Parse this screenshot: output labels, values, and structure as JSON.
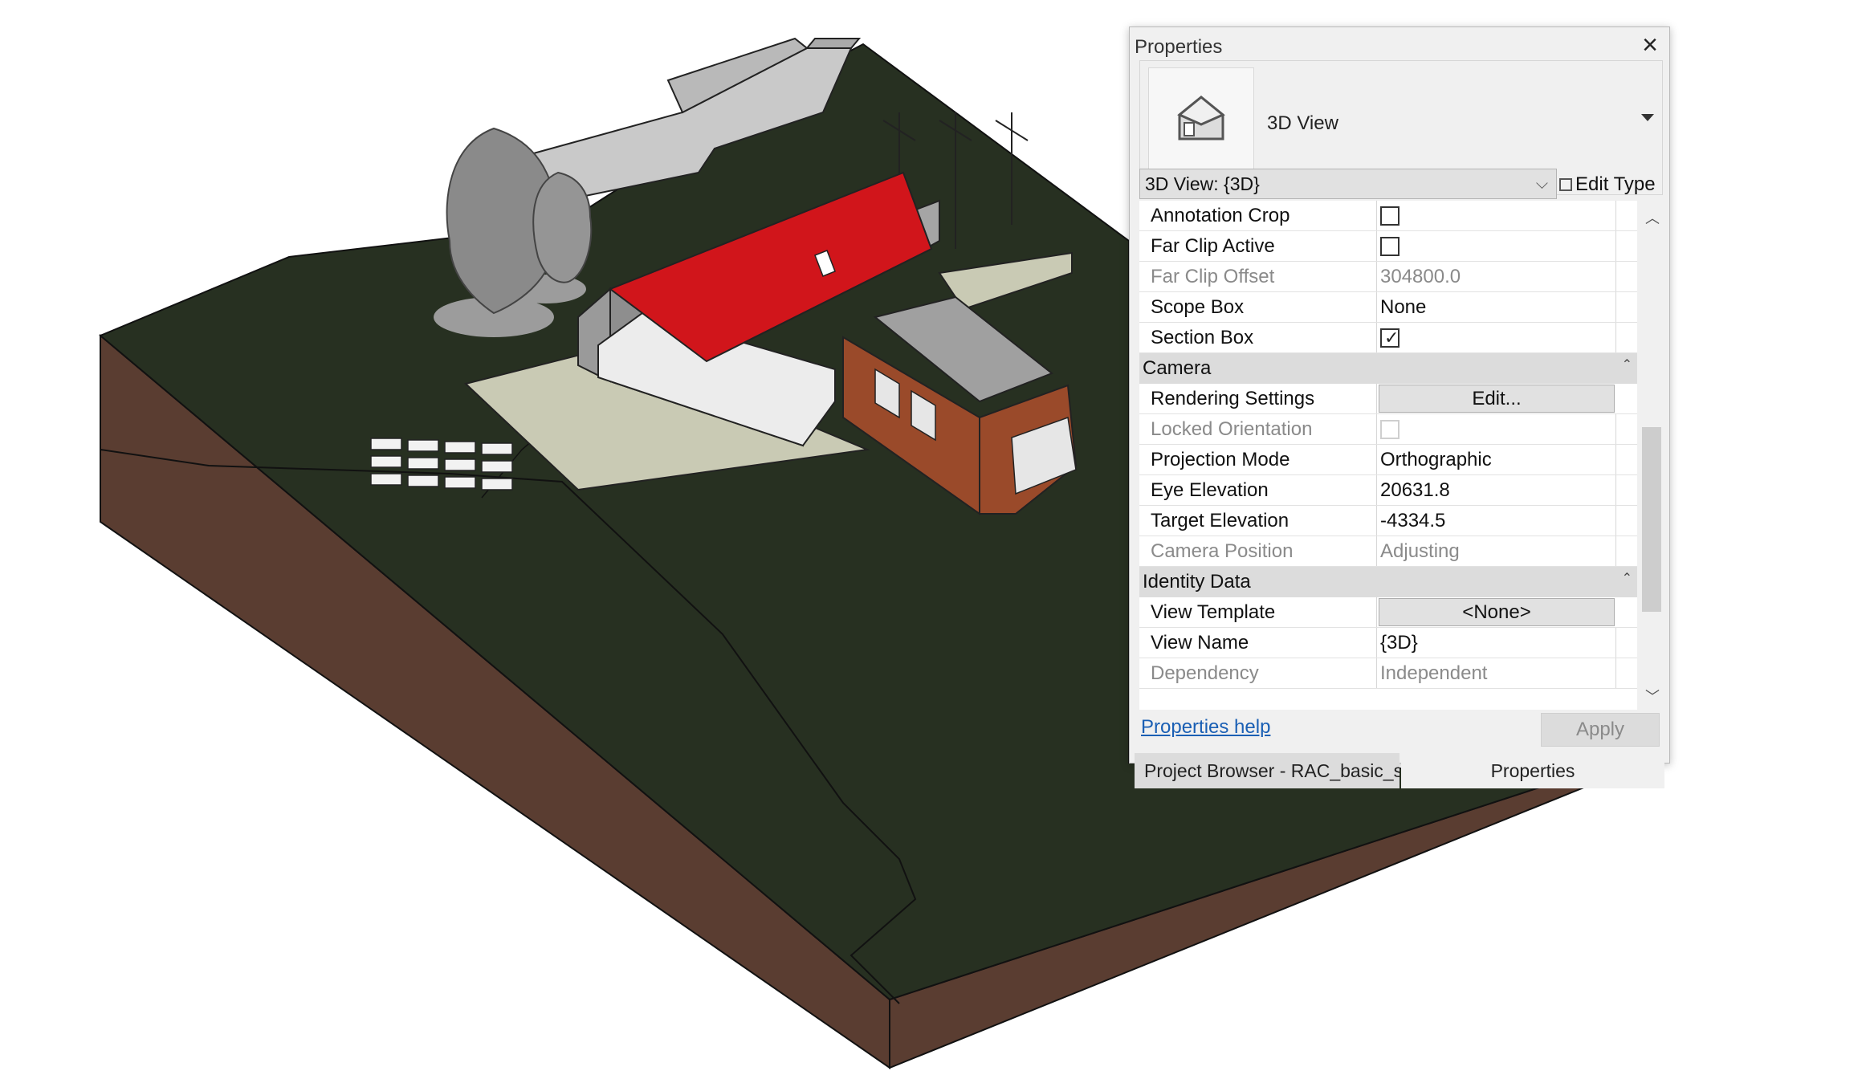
{
  "palette": {
    "title": "Properties",
    "type_name": "3D View",
    "instance": "3D View: {3D}",
    "edit_type": "Edit Type",
    "help_link": "Properties help",
    "apply": "Apply"
  },
  "rows": {
    "annotation_crop": {
      "name": "Annotation Crop",
      "checked": false
    },
    "far_clip_active": {
      "name": "Far Clip Active",
      "checked": false
    },
    "far_clip_offset": {
      "name": "Far Clip Offset",
      "value": "304800.0"
    },
    "scope_box": {
      "name": "Scope Box",
      "value": "None"
    },
    "section_box": {
      "name": "Section Box",
      "checked": true
    },
    "camera_group": "Camera",
    "rendering_settings": {
      "name": "Rendering Settings",
      "value": "Edit..."
    },
    "locked_orientation": {
      "name": "Locked Orientation",
      "checked": false
    },
    "projection_mode": {
      "name": "Projection Mode",
      "value": "Orthographic"
    },
    "eye_elevation": {
      "name": "Eye Elevation",
      "value": "20631.8"
    },
    "target_elevation": {
      "name": "Target Elevation",
      "value": "-4334.5"
    },
    "camera_position": {
      "name": "Camera Position",
      "value": "Adjusting"
    },
    "identity_group": "Identity Data",
    "view_template": {
      "name": "View Template",
      "value": "<None>"
    },
    "view_name": {
      "name": "View Name",
      "value": "{3D}"
    },
    "dependency": {
      "name": "Dependency",
      "value": "Independent"
    }
  },
  "tabs": {
    "project_browser": "Project Browser - RAC_basic_s",
    "properties": "Properties"
  },
  "colors": {
    "terrain_top": "#273021",
    "terrain_side": "#5a3d31",
    "roof": "#d1151b",
    "cladding": "#9a4a2a",
    "walls": "#9a9a9a"
  }
}
